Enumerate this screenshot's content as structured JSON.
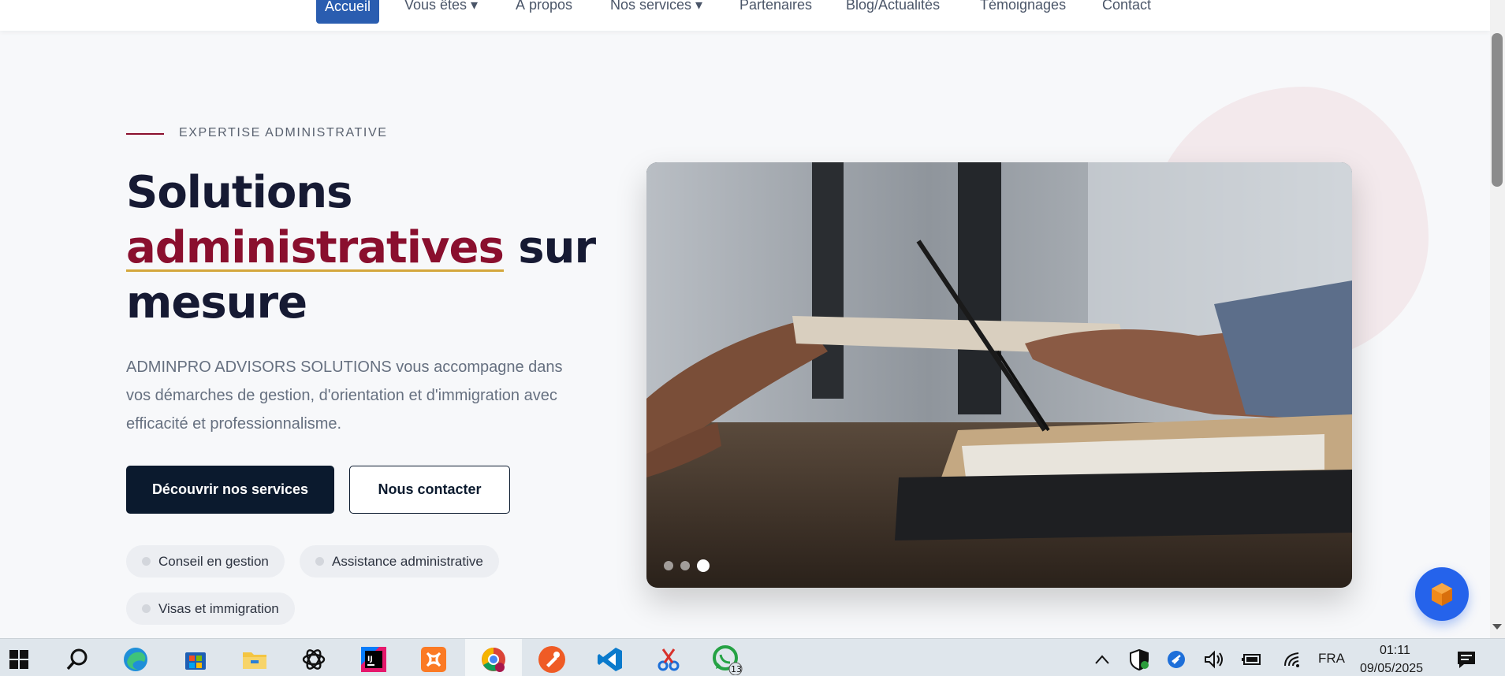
{
  "nav": {
    "active": "Accueil",
    "items": [
      "Vous êtes ▾",
      "À propos",
      "Nos services ▾",
      "Partenaires",
      "Blog/Actualités",
      "Témoignages",
      "Contact"
    ]
  },
  "hero": {
    "eyebrow": "EXPERTISE ADMINISTRATIVE",
    "title_line1": "Solutions",
    "title_accent": "administratives",
    "title_after_accent": " sur",
    "title_line3": "mesure",
    "lead": "ADMINPRO ADVISORS SOLUTIONS vous accompagne dans vos démarches de gestion, d'orientation et d'immigration avec efficacité et professionnalisme.",
    "primary_button": "Découvrir nos services",
    "secondary_button": "Nous contacter",
    "chips": [
      "Conseil en gestion",
      "Assistance administrative",
      "Visas et immigration"
    ],
    "carousel": {
      "total": 3,
      "active": 3
    }
  },
  "colors": {
    "accent": "#8a0f2e",
    "underline": "#d4a73c",
    "navy": "#0b1a2e",
    "nav_active": "#2a5db0",
    "fab": "#2563eb"
  },
  "taskbar": {
    "apps": [
      "start-icon",
      "search-icon",
      "edge-icon",
      "store-icon",
      "file-explorer-icon",
      "chatgpt-icon",
      "intellij-icon",
      "xampp-icon",
      "chrome-icon",
      "postman-icon",
      "vscode-icon",
      "snipping-tool-icon",
      "whatsapp-icon"
    ],
    "whatsapp_badge": "13",
    "language": "FRA",
    "time": "01:11",
    "date": "09/05/2025"
  }
}
